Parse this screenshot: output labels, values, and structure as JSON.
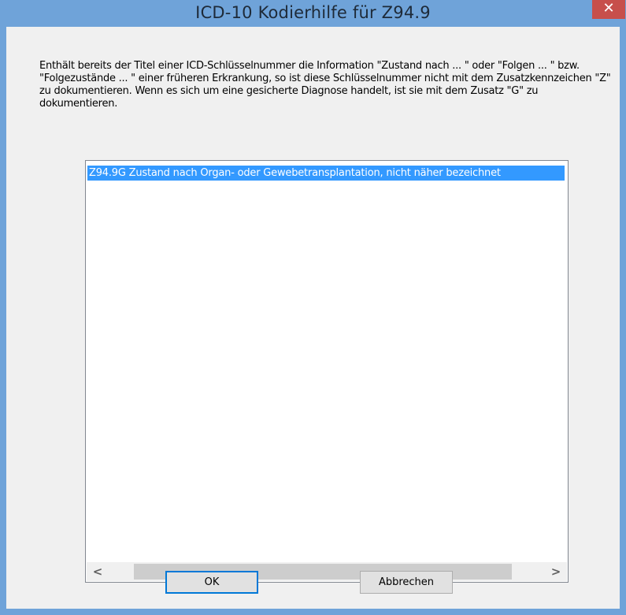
{
  "window": {
    "title": "ICD-10 Kodierhilfe für Z94.9",
    "close_glyph": "✕"
  },
  "message": "Enthält bereits der Titel einer ICD-Schlüsselnummer die Information \"Zustand nach ... \" oder \"Folgen ... \" bzw. \"Folgezustände ... \" einer früheren Erkrankung, so ist diese Schlüsselnummer nicht mit dem Zusatzkennzeichen \"Z\" zu dokumentieren. Wenn es sich um eine gesicherte Diagnose handelt, ist sie mit dem Zusatz \"G\" zu dokumentieren.",
  "listbox": {
    "items": [
      {
        "label": "Z94.9G Zustand nach Organ- oder Gewebetransplantation, nicht näher bezeichnet",
        "selected": true
      }
    ],
    "scroll_left_glyph": "<",
    "scroll_right_glyph": ">"
  },
  "buttons": {
    "ok": "OK",
    "cancel": "Abbrechen"
  },
  "colors": {
    "titlebar": "#6fa3d9",
    "close": "#c74f4b",
    "selection": "#3399ff",
    "dialog_bg": "#f0f0f0"
  }
}
